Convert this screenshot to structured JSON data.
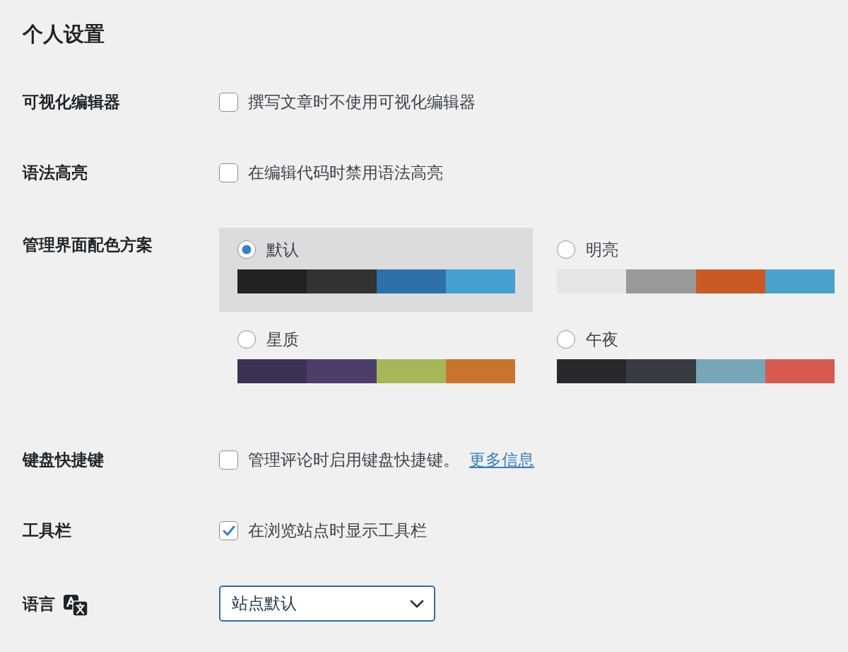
{
  "title": "个人设置",
  "settings": [
    {
      "kind": "checkbox",
      "label": "可视化编辑器",
      "text": "撰写文章时不使用可视化编辑器",
      "checked": false
    },
    {
      "kind": "checkbox",
      "label": "语法高亮",
      "text": "在编辑代码时禁用语法高亮",
      "checked": false
    },
    {
      "kind": "color_scheme",
      "label": "管理界面配色方案",
      "schemes": [
        {
          "name": "默认",
          "selected": true,
          "swatches": [
            {
              "color": "#222222"
            },
            {
              "color": "#333333"
            },
            {
              "color": "#2e71aa"
            },
            {
              "color": "#45a0d1"
            }
          ]
        },
        {
          "name": "明亮",
          "selected": false,
          "swatches": [
            {
              "color": "#e5e5e5"
            },
            {
              "color": "#999999"
            },
            {
              "color": "#c95a27"
            },
            {
              "color": "#4aa2cc"
            }
          ]
        },
        {
          "name": "星质",
          "selected": false,
          "swatches": [
            {
              "color": "#3d3253"
            },
            {
              "color": "#4f3d69"
            },
            {
              "color": "#a6b75a"
            },
            {
              "color": "#c8742f"
            }
          ]
        },
        {
          "name": "午夜",
          "selected": false,
          "swatches": [
            {
              "color": "#26282c"
            },
            {
              "color": "#383b41"
            },
            {
              "color": "#77a6b8"
            },
            {
              "color": "#d65a4e"
            }
          ]
        }
      ]
    },
    {
      "kind": "checkbox",
      "label": "键盘快捷键",
      "text": "管理评论时启用键盘快捷键。",
      "link": "更多信息",
      "checked": false
    },
    {
      "kind": "checkbox",
      "label": "工具栏",
      "text": "在浏览站点时显示工具栏",
      "checked": true
    },
    {
      "kind": "select",
      "label": "语言",
      "value": "站点默认"
    }
  ]
}
